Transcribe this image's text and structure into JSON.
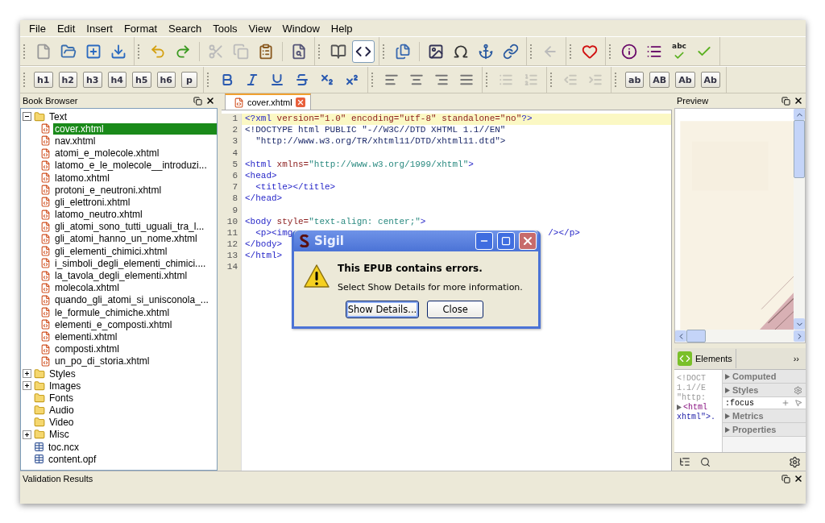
{
  "menu": [
    "File",
    "Edit",
    "Insert",
    "Format",
    "Search",
    "Tools",
    "View",
    "Window",
    "Help"
  ],
  "toolbar_main": [
    {
      "items": [
        {
          "kind": "icon",
          "disabled": false,
          "selected": false
        },
        {
          "kind": "icon",
          "disabled": false,
          "selected": false
        },
        {
          "kind": "icon",
          "disabled": false,
          "selected": false
        },
        {
          "kind": "icon",
          "disabled": false,
          "selected": false
        }
      ]
    },
    {
      "items": [
        {
          "kind": "icon",
          "disabled": false,
          "selected": false
        },
        {
          "kind": "icon",
          "disabled": false,
          "selected": false
        },
        {
          "kind": "separator"
        },
        {
          "kind": "icon",
          "disabled": true,
          "selected": false
        },
        {
          "kind": "icon",
          "disabled": true,
          "selected": false
        },
        {
          "kind": "icon",
          "disabled": false,
          "selected": false
        },
        {
          "kind": "separator"
        },
        {
          "kind": "icon",
          "disabled": false,
          "selected": false
        }
      ]
    },
    {
      "items": [
        {
          "kind": "icon",
          "disabled": false,
          "selected": false
        },
        {
          "kind": "icon",
          "disabled": false,
          "selected": true
        }
      ]
    },
    {
      "items": [
        {
          "kind": "icon",
          "disabled": false,
          "selected": false
        },
        {
          "kind": "separator"
        },
        {
          "kind": "icon",
          "disabled": false,
          "selected": false
        },
        {
          "kind": "icon",
          "disabled": false,
          "selected": false
        },
        {
          "kind": "icon",
          "disabled": false,
          "selected": false
        },
        {
          "kind": "icon",
          "disabled": false,
          "selected": false
        }
      ]
    },
    {
      "items": [
        {
          "kind": "icon",
          "disabled": true,
          "selected": false
        }
      ]
    },
    {
      "items": [
        {
          "kind": "icon",
          "disabled": false,
          "selected": false
        }
      ]
    },
    {
      "items": [
        {
          "kind": "icon",
          "disabled": false,
          "selected": false
        },
        {
          "kind": "icon",
          "disabled": false,
          "selected": false
        },
        {
          "kind": "spell",
          "label": "abc",
          "disabled": false
        },
        {
          "kind": "icon",
          "disabled": false,
          "selected": false
        }
      ]
    }
  ],
  "toolbar_format": [
    {
      "items": [
        {
          "kind": "label",
          "label": "h1",
          "disabled": false
        },
        {
          "kind": "label",
          "label": "h2",
          "disabled": false
        },
        {
          "kind": "label",
          "label": "h3",
          "disabled": false
        },
        {
          "kind": "label",
          "label": "h4",
          "disabled": false
        },
        {
          "kind": "label",
          "label": "h5",
          "disabled": false
        },
        {
          "kind": "label",
          "label": "h6",
          "disabled": false
        },
        {
          "kind": "label",
          "label": "p",
          "disabled": false
        }
      ]
    },
    {
      "items": [
        {
          "kind": "icon",
          "disabled": false
        },
        {
          "kind": "icon",
          "disabled": false
        },
        {
          "kind": "icon",
          "disabled": false
        },
        {
          "kind": "icon",
          "disabled": false
        },
        {
          "kind": "icon",
          "disabled": false
        },
        {
          "kind": "icon",
          "disabled": false
        }
      ]
    },
    {
      "items": [
        {
          "kind": "icon",
          "disabled": false
        },
        {
          "kind": "icon",
          "disabled": false
        },
        {
          "kind": "icon",
          "disabled": false
        },
        {
          "kind": "icon",
          "disabled": false
        }
      ]
    },
    {
      "items": [
        {
          "kind": "icon",
          "disabled": true
        },
        {
          "kind": "icon",
          "disabled": true
        }
      ]
    },
    {
      "items": [
        {
          "kind": "icon",
          "disabled": true
        },
        {
          "kind": "icon",
          "disabled": true
        }
      ]
    },
    {
      "items": [
        {
          "kind": "label",
          "label": "ab",
          "disabled": false
        },
        {
          "kind": "label",
          "label": "AB",
          "disabled": false
        },
        {
          "kind": "label",
          "label": "Ab",
          "disabled": false
        },
        {
          "kind": "label",
          "label": "Ab",
          "disabled": false
        }
      ]
    }
  ],
  "book_browser": {
    "title": "Book Browser",
    "tree": [
      {
        "label": "Text",
        "kind": "folder",
        "expandable": true,
        "expanded": true,
        "selected": false,
        "children": [
          {
            "label": "cover.xhtml",
            "kind": "page",
            "selected": true
          },
          {
            "label": "nav.xhtml",
            "kind": "page",
            "selected": false
          },
          {
            "label": "atomi_e_molecole.xhtml",
            "kind": "page",
            "selected": false
          },
          {
            "label": "latomo_e_le_molecole__introduzi...",
            "kind": "page",
            "selected": false
          },
          {
            "label": "latomo.xhtml",
            "kind": "page",
            "selected": false
          },
          {
            "label": "protoni_e_neutroni.xhtml",
            "kind": "page",
            "selected": false
          },
          {
            "label": "gli_elettroni.xhtml",
            "kind": "page",
            "selected": false
          },
          {
            "label": "latomo_neutro.xhtml",
            "kind": "page",
            "selected": false
          },
          {
            "label": "gli_atomi_sono_tutti_uguali_tra_l...",
            "kind": "page",
            "selected": false
          },
          {
            "label": "gli_atomi_hanno_un_nome.xhtml",
            "kind": "page",
            "selected": false
          },
          {
            "label": "gli_elementi_chimici.xhtml",
            "kind": "page",
            "selected": false
          },
          {
            "label": "i_simboli_degli_elementi_chimici....",
            "kind": "page",
            "selected": false
          },
          {
            "label": "la_tavola_degli_elementi.xhtml",
            "kind": "page",
            "selected": false
          },
          {
            "label": "molecola.xhtml",
            "kind": "page",
            "selected": false
          },
          {
            "label": "quando_gli_atomi_si_unisconola_...",
            "kind": "page",
            "selected": false
          },
          {
            "label": "le_formule_chimiche.xhtml",
            "kind": "page",
            "selected": false
          },
          {
            "label": "elementi_e_composti.xhtml",
            "kind": "page",
            "selected": false
          },
          {
            "label": "elementi.xhtml",
            "kind": "page",
            "selected": false
          },
          {
            "label": "composti.xhtml",
            "kind": "page",
            "selected": false
          },
          {
            "label": "un_po_di_storia.xhtml",
            "kind": "page",
            "selected": false
          }
        ]
      },
      {
        "label": "Styles",
        "kind": "folder",
        "expandable": true,
        "expanded": false,
        "selected": false
      },
      {
        "label": "Images",
        "kind": "folder",
        "expandable": true,
        "expanded": false,
        "selected": false
      },
      {
        "label": "Fonts",
        "kind": "folder",
        "expandable": false,
        "selected": false
      },
      {
        "label": "Audio",
        "kind": "folder",
        "expandable": false,
        "selected": false
      },
      {
        "label": "Video",
        "kind": "folder",
        "expandable": false,
        "selected": false
      },
      {
        "label": "Misc",
        "kind": "folder",
        "expandable": true,
        "expanded": false,
        "selected": false
      },
      {
        "label": "toc.ncx",
        "kind": "table",
        "selected": false
      },
      {
        "label": "content.opf",
        "kind": "table",
        "selected": false
      }
    ]
  },
  "editor": {
    "tabs": [
      {
        "label": "cover.xhtml",
        "selected": true
      }
    ],
    "lines": [
      {
        "number": "1",
        "current": true,
        "tokens": [
          {
            "kind": "tag",
            "text": "<?xml"
          },
          {
            "kind": "attr",
            "text": " version=\"1.0\" encoding=\"utf-8\" standalone=\"no\""
          },
          {
            "kind": "tag",
            "text": "?>"
          }
        ]
      },
      {
        "number": "2",
        "current": false,
        "tokens": [
          {
            "kind": "doctype",
            "text": "<!DOCTYPE html PUBLIC \"-//W3C//DTD XHTML 1.1//EN\""
          }
        ]
      },
      {
        "number": "3",
        "current": false,
        "tokens": [
          {
            "kind": "doctype",
            "text": "  \"http://www.w3.org/TR/xhtml11/DTD/xhtml11.dtd\">"
          }
        ]
      },
      {
        "number": "4",
        "current": false
      },
      {
        "number": "5",
        "current": false,
        "tokens": [
          {
            "kind": "tag",
            "text": "<html"
          },
          {
            "kind": "attr",
            "text": " xmlns="
          },
          {
            "kind": "value",
            "text": "\"http://www.w3.org/1999/xhtml\""
          },
          {
            "kind": "tag",
            "text": ">"
          }
        ]
      },
      {
        "number": "6",
        "current": false,
        "tokens": [
          {
            "kind": "tag",
            "text": "<head>"
          }
        ]
      },
      {
        "number": "7",
        "current": false,
        "tokens": [
          {
            "kind": "tag",
            "text": "  <title></title>"
          }
        ]
      },
      {
        "number": "8",
        "current": false,
        "tokens": [
          {
            "kind": "tag",
            "text": "</head>"
          }
        ]
      },
      {
        "number": "9",
        "current": false
      },
      {
        "number": "10",
        "current": false,
        "tokens": [
          {
            "kind": "tag",
            "text": "<body"
          },
          {
            "kind": "attr",
            "text": " style="
          },
          {
            "kind": "value",
            "text": "\"text-align: center;\""
          },
          {
            "kind": "tag",
            "text": ">"
          }
        ]
      },
      {
        "number": "11",
        "current": false,
        "tokens": [
          {
            "kind": "tag",
            "text": "  <p><img"
          }
        ],
        "tail": [
          {
            "kind": "tag",
            "text": "/></p>"
          }
        ]
      },
      {
        "number": "12",
        "current": false,
        "tokens": [
          {
            "kind": "tag",
            "text": "</body>"
          }
        ]
      },
      {
        "number": "13",
        "current": false,
        "tokens": [
          {
            "kind": "tag",
            "text": "</html>"
          }
        ]
      },
      {
        "number": "14",
        "current": false
      }
    ]
  },
  "dialog": {
    "title": "Sigil",
    "heading": "This EPUB contains errors.",
    "message": "Select Show Details for more information.",
    "buttons": [
      {
        "label": "Show Details...",
        "focused": true
      },
      {
        "label": "Close",
        "focused": false
      }
    ]
  },
  "preview": {
    "title": "Preview"
  },
  "inspector": {
    "tab": "Elements",
    "more": "››",
    "code": [
      {
        "text": "<!DOCT",
        "kind": "dim"
      },
      {
        "text": "1.1//E",
        "kind": "dim"
      },
      {
        "text": "\"http:",
        "kind": "dim"
      },
      {
        "text": "<html",
        "kind": "node"
      },
      {
        "text": "xhtml\">.",
        "kind": "attr"
      }
    ],
    "sections": [
      {
        "label": "Computed",
        "kind": "section"
      },
      {
        "label": "Styles",
        "kind": "section"
      },
      {
        "label": ":focus",
        "kind": "rule"
      },
      {
        "label": "Metrics",
        "kind": "section"
      },
      {
        "label": "Properties",
        "kind": "section"
      }
    ]
  },
  "validation": {
    "title": "Validation Results"
  }
}
